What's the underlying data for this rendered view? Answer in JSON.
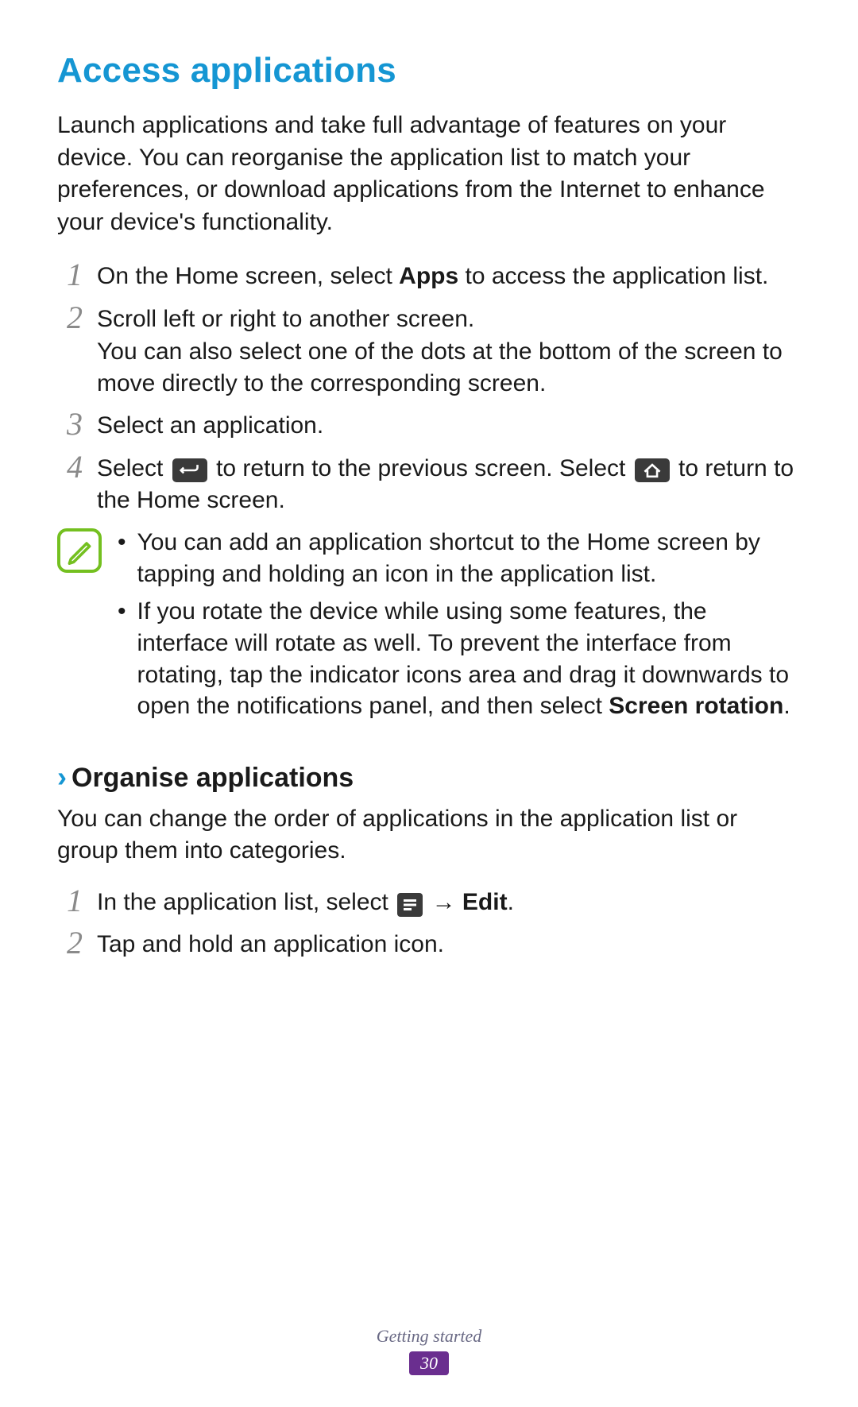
{
  "heading": "Access applications",
  "intro": "Launch applications and take full advantage of features on your device. You can reorganise the application list to match your preferences, or download applications from the Internet to enhance your device's functionality.",
  "steps": {
    "n1": "1",
    "s1a": "On the Home screen, select ",
    "s1_apps": "Apps",
    "s1b": " to access the application list.",
    "n2": "2",
    "s2a": "Scroll left or right to another screen.",
    "s2b": "You can also select one of the dots at the bottom of the screen to move directly to the corresponding screen.",
    "n3": "3",
    "s3": "Select an application.",
    "n4": "4",
    "s4a": "Select ",
    "s4b": " to return to the previous screen. Select ",
    "s4c": " to return to the Home screen."
  },
  "note": {
    "b1": "You can add an application shortcut to the Home screen by tapping and holding an icon in the application list.",
    "b2a": "If you rotate the device while using some features, the interface will rotate as well. To prevent the interface from rotating, tap the indicator icons area and drag it downwards to open the notifications panel, and then select ",
    "b2_bold": "Screen rotation",
    "b2b": "."
  },
  "sub": {
    "heading": "Organise applications",
    "intro": "You can change the order of applications in the application list or group them into categories.",
    "n1": "1",
    "s1a": "In the application list, select ",
    "s1_arrow": " → ",
    "s1_edit": "Edit",
    "s1b": ".",
    "n2": "2",
    "s2": "Tap and hold an application icon."
  },
  "footer": {
    "section": "Getting started",
    "page": "30"
  },
  "bullet": "•"
}
